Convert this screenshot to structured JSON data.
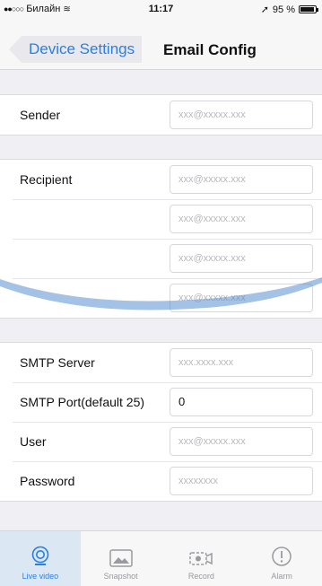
{
  "status_bar": {
    "carrier": "Билайн",
    "time": "11:17",
    "battery": "95 %",
    "battery_level": 0.95
  },
  "nav": {
    "back_label": "Device Settings",
    "title": "Email Config"
  },
  "sender": {
    "label": "Sender",
    "placeholder": "xxx@xxxxx.xxx"
  },
  "recipient": {
    "label": "Recipient",
    "placeholders": [
      "xxx@xxxxx.xxx",
      "xxx@xxxxx.xxx",
      "xxx@xxxxx.xxx",
      "xxx@xxxxx.xxx"
    ]
  },
  "smtp": {
    "server_label": "SMTP Server",
    "server_placeholder": "xxx.xxxx.xxx",
    "port_label": "SMTP Port(default 25)",
    "port_value": "0",
    "user_label": "User",
    "user_placeholder": "xxx@xxxxx.xxx",
    "password_label": "Password",
    "password_placeholder": "xxxxxxxx"
  },
  "tabs": [
    {
      "label": "Live video",
      "icon": "webcam-icon",
      "active": true
    },
    {
      "label": "Snapshot",
      "icon": "image-icon",
      "active": false
    },
    {
      "label": "Record",
      "icon": "video-camera-icon",
      "active": false
    },
    {
      "label": "Alarm",
      "icon": "alert-icon",
      "active": false
    }
  ],
  "colors": {
    "accent": "#2a7fe0",
    "background": "#efeff4"
  }
}
